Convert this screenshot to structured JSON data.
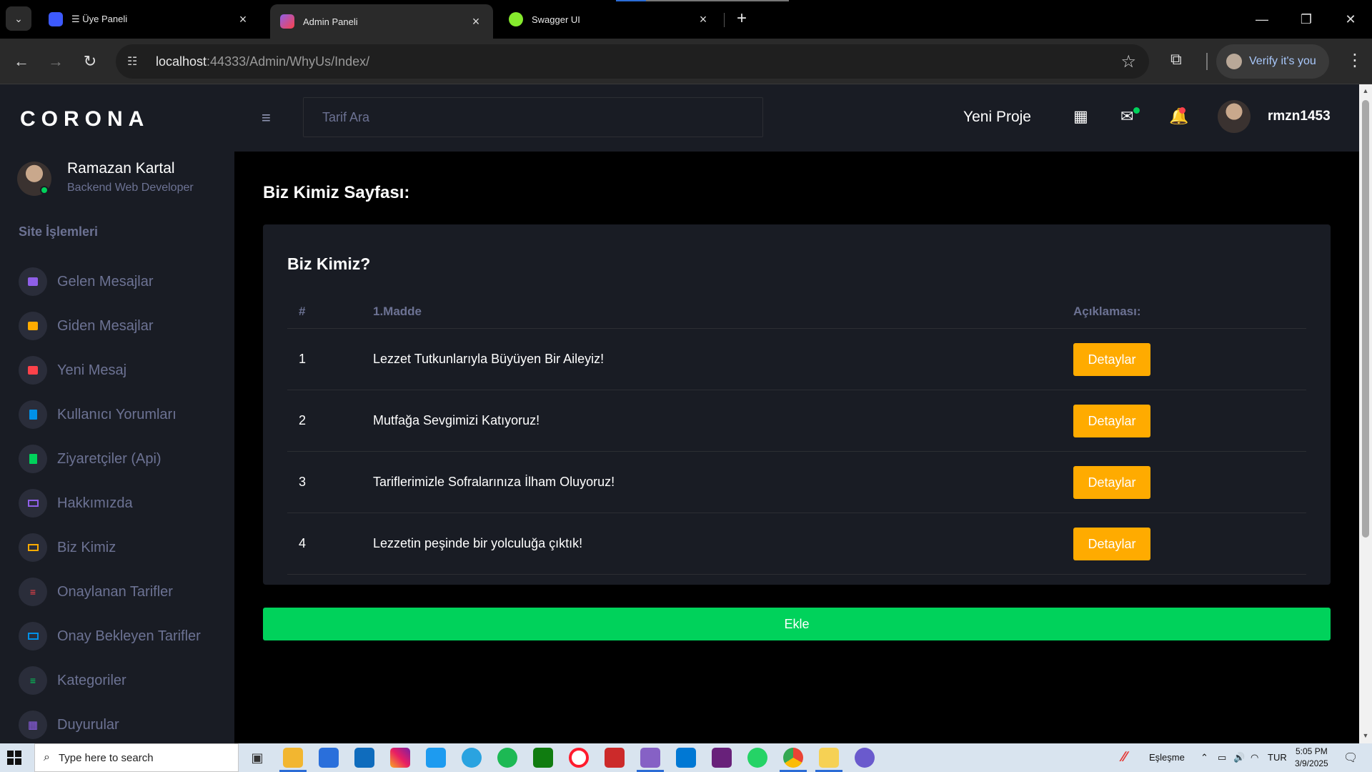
{
  "browser": {
    "tabs": [
      {
        "title": "☰ Üye Paneli",
        "active": false
      },
      {
        "title": "Admin Paneli",
        "active": true
      },
      {
        "title": "Swagger UI",
        "active": false
      }
    ],
    "url_host": "localhost",
    "url_path": ":44333/Admin/WhyUs/Index/",
    "verify_label": "Verify it's you"
  },
  "sidebar": {
    "brand": "CORONA",
    "profile_name": "Ramazan Kartal",
    "profile_role": "Backend Web Developer",
    "section_title": "Site İşlemleri",
    "items": [
      {
        "label": "Gelen Mesajlar",
        "icon": "message-icon",
        "color": "#8f5fe8"
      },
      {
        "label": "Giden Mesajlar",
        "icon": "message-icon",
        "color": "#ffab00"
      },
      {
        "label": "Yeni Mesaj",
        "icon": "message-icon",
        "color": "#fc424a"
      },
      {
        "label": "Kullanıcı Yorumları",
        "icon": "document-icon",
        "color": "#0090e7"
      },
      {
        "label": "Ziyaretçiler (Api)",
        "icon": "document-icon",
        "color": "#00d25b"
      },
      {
        "label": "Hakkımızda",
        "icon": "laptop-icon",
        "color": "#8f5fe8"
      },
      {
        "label": "Biz Kimiz",
        "icon": "laptop-icon",
        "color": "#ffab00"
      },
      {
        "label": "Onaylanan Tarifler",
        "icon": "playlist-icon",
        "color": "#fc424a"
      },
      {
        "label": "Onay Bekleyen Tarifler",
        "icon": "laptop-icon",
        "color": "#0090e7"
      },
      {
        "label": "Kategoriler",
        "icon": "playlist-icon",
        "color": "#00d25b"
      },
      {
        "label": "Duyurular",
        "icon": "table-icon",
        "color": "#8f5fe8"
      }
    ]
  },
  "topnav": {
    "search_placeholder": "Tarif Ara",
    "new_project": "Yeni Proje",
    "username": "rmzn1453"
  },
  "main": {
    "page_title": "Biz Kimiz Sayfası:",
    "card_title": "Biz Kimiz?",
    "columns": [
      "#",
      "1.Madde",
      "Açıklaması:"
    ],
    "rows": [
      {
        "no": "1",
        "madde": "Lezzet Tutkunlarıyla Büyüyen Bir Aileyiz!",
        "button": "Detaylar"
      },
      {
        "no": "2",
        "madde": "Mutfağa Sevgimizi Katıyoruz!",
        "button": "Detaylar"
      },
      {
        "no": "3",
        "madde": "Tariflerimizle Sofralarınıza İlham Oluyoruz!",
        "button": "Detaylar"
      },
      {
        "no": "4",
        "madde": "Lezzetin peşinde bir yolculuğa çıktık!",
        "button": "Detaylar"
      }
    ],
    "add_button": "Ekle"
  },
  "taskbar": {
    "search_placeholder": "Type here to search",
    "sync_label": "Eşleşme",
    "language": "TUR",
    "time": "5:05 PM",
    "date": "3/9/2025"
  }
}
